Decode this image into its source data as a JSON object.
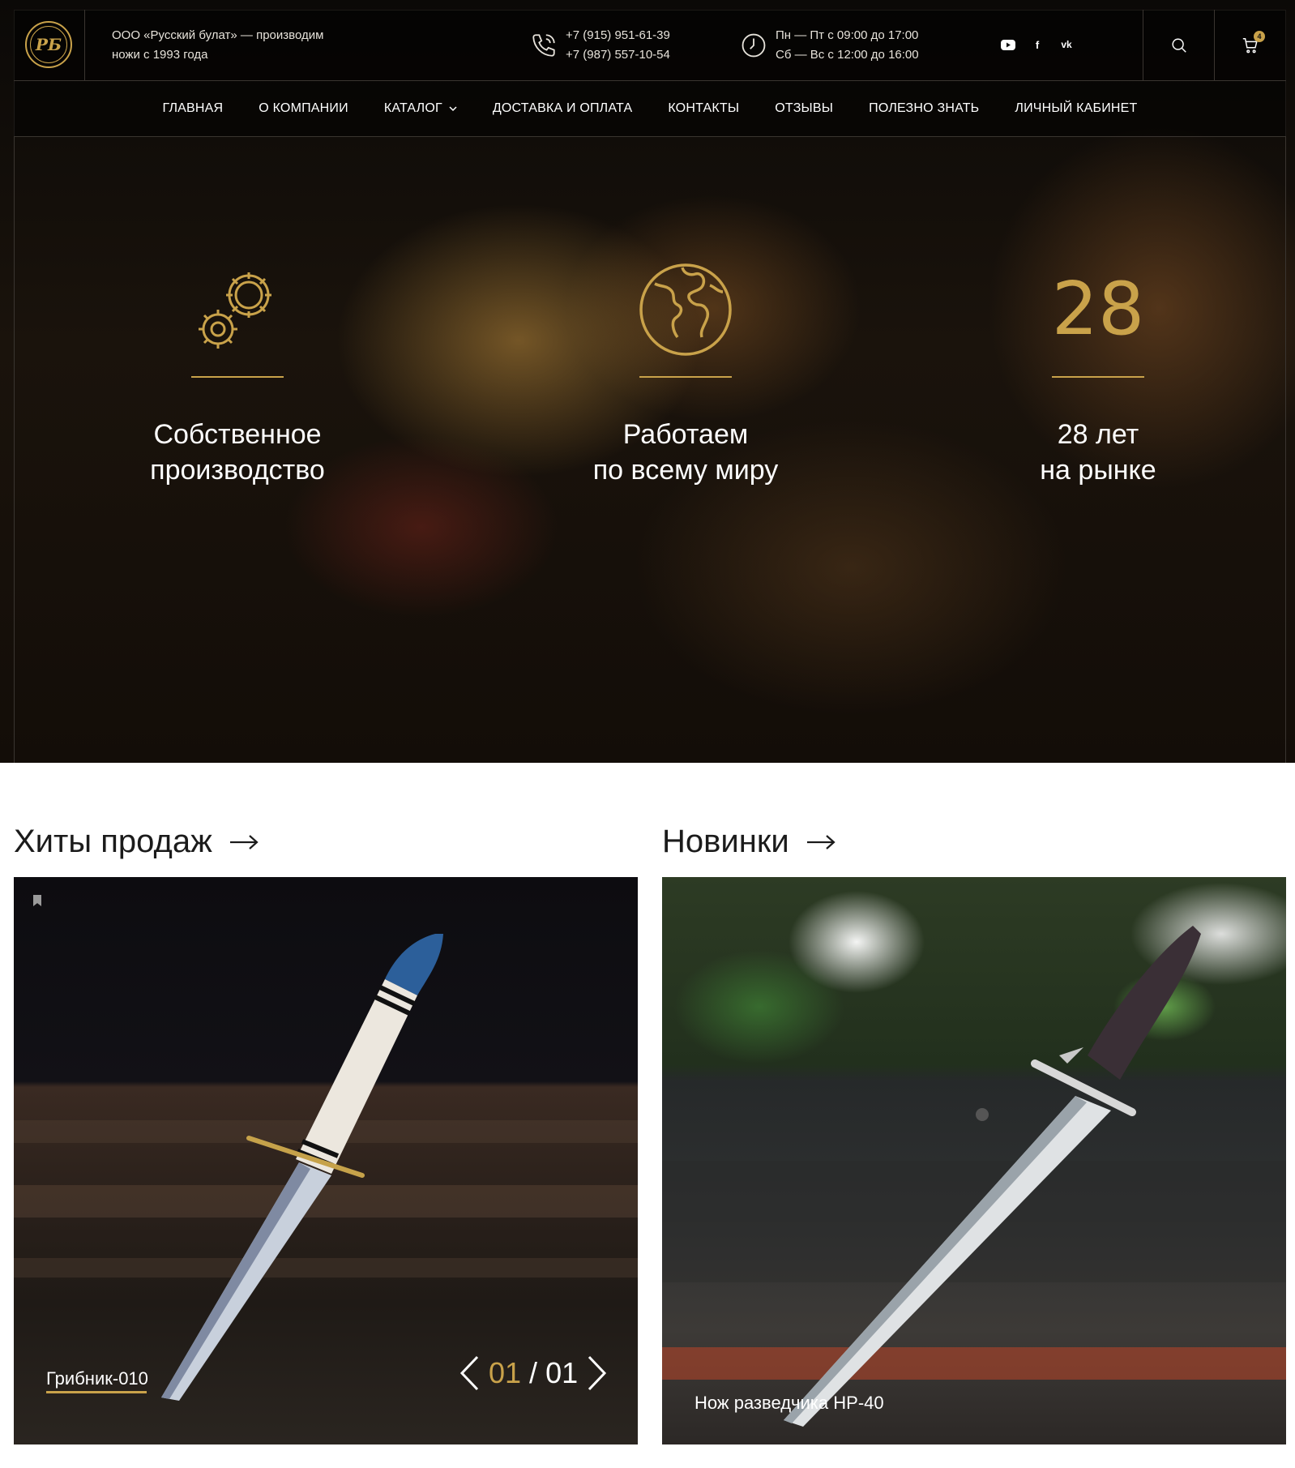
{
  "header": {
    "tagline_line1": "ООО «Русский булат» — производим",
    "tagline_line2": "ножи с 1993 года",
    "phone1": "+7 (915) 951-61-39",
    "phone2": "+7 (987) 557-10-54",
    "hours1": "Пн — Пт с 09:00 до 17:00",
    "hours2": "Сб — Вс с 12:00 до 16:00",
    "cart_count": "4",
    "socials": [
      "youtube-icon",
      "facebook-icon",
      "vk-icon"
    ]
  },
  "nav": {
    "items": [
      {
        "label": "ГЛАВНАЯ"
      },
      {
        "label": "О КОМПАНИИ"
      },
      {
        "label": "КАТАЛОГ"
      },
      {
        "label": "ДОСТАВКА И ОПЛАТА"
      },
      {
        "label": "КОНТАКТЫ"
      },
      {
        "label": "ОТЗЫВЫ"
      },
      {
        "label": "ПОЛЕЗНО ЗНАТЬ"
      },
      {
        "label": "ЛИЧНЫЙ КАБИНЕТ"
      }
    ]
  },
  "features": [
    {
      "icon": "gears-icon",
      "line1": "Собственное",
      "line2": "производство"
    },
    {
      "icon": "globe-icon",
      "line1": "Работаем",
      "line2": "по всему миру"
    },
    {
      "number": "28",
      "line1": "28 лет",
      "line2": "на рынке"
    }
  ],
  "sections": {
    "hits_title": "Хиты продаж",
    "new_title": "Новинки"
  },
  "products": {
    "hit_name": "Грибник-010",
    "hit_page_current": "01",
    "hit_page_sep": "/",
    "hit_page_total": "01",
    "new_name": "Нож разведчика НР-40"
  },
  "colors": {
    "accent": "#c9a24a",
    "dark": "#0b0907"
  }
}
